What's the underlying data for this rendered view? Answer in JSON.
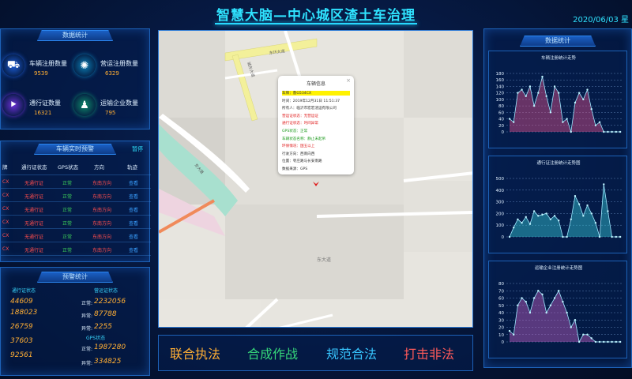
{
  "header": {
    "title": "智慧大脑—中心城区渣土车治理",
    "date": "2020/06/03 星"
  },
  "stats": {
    "title": "数据统计",
    "items": [
      {
        "label": "车辆注册数量",
        "value": "9539",
        "color": "#1d5dd8",
        "icon": "truck-icon",
        "glyph": "⛟"
      },
      {
        "label": "营运注册数量",
        "value": "6329",
        "color": "#0b7fb5",
        "icon": "network-icon",
        "glyph": "✺"
      },
      {
        "label": "通行证数量",
        "value": "16321",
        "color": "#6b2fd6",
        "icon": "pass-icon",
        "glyph": "⯈"
      },
      {
        "label": "运输企业数量",
        "value": "795",
        "color": "#0e8a6a",
        "icon": "enterprise-icon",
        "glyph": "♟"
      }
    ]
  },
  "warnings": {
    "title": "车辆实时预警",
    "pause": "暂停",
    "columns": [
      "牌",
      "通行证状态",
      "GPS状态",
      "方向",
      "轨迹"
    ],
    "rows": [
      {
        "plate": "CX",
        "pass": "无通行证",
        "gps": "正常",
        "dir": "东南方向",
        "track": "查看"
      },
      {
        "plate": "CX",
        "pass": "无通行证",
        "gps": "正常",
        "dir": "东南方向",
        "track": "查看"
      },
      {
        "plate": "CX",
        "pass": "无通行证",
        "gps": "正常",
        "dir": "东南方向",
        "track": "查看"
      },
      {
        "plate": "CX",
        "pass": "无通行证",
        "gps": "正常",
        "dir": "东南方向",
        "track": "查看"
      },
      {
        "plate": "CX",
        "pass": "无通行证",
        "gps": "正常",
        "dir": "东南方向",
        "track": "查看"
      },
      {
        "plate": "CX",
        "pass": "无通行证",
        "gps": "正常",
        "dir": "东南方向",
        "track": "查看"
      }
    ]
  },
  "alarm": {
    "title": "预警统计",
    "pass_title": "通行证状态",
    "op_title": "营运证状态",
    "gps_title": "GPS状态",
    "left": [
      {
        "label": "",
        "value": "44609"
      },
      {
        "label": "",
        "value": "188023"
      },
      {
        "label": "",
        "value": "26759"
      },
      {
        "label": "",
        "value": "37603"
      },
      {
        "label": "",
        "value": "92561"
      }
    ],
    "right": [
      {
        "label": "正常:",
        "value": "2232056"
      },
      {
        "label": "异常:",
        "value": "87788"
      },
      {
        "label": "异常:",
        "value": "2255"
      },
      {
        "label": "正常:",
        "value": "1987280"
      },
      {
        "label": "异常:",
        "value": "334825"
      }
    ]
  },
  "map": {
    "road1": "城东大道",
    "road2": "东环大道",
    "road3": "东大道",
    "road4": "东大道"
  },
  "popup": {
    "title": "车辆信息",
    "rows": [
      {
        "text": "车牌：鲁G534CX",
        "color": "#333",
        "highlight": true
      },
      {
        "text": "时间：2019年12月31日 11:51:37",
        "color": "#333"
      },
      {
        "text": "所有人：临沂市宏宏渣运有限公司",
        "color": "#333"
      },
      {
        "text": "营运证状态：无营运证",
        "color": "#e02020"
      },
      {
        "text": "通行证状态：时间异常",
        "color": "#e02020"
      },
      {
        "text": "GPS状态：正常",
        "color": "#1a9a1a"
      },
      {
        "text": "车辆状态名称：静止未起吊",
        "color": "#1a9a1a"
      },
      {
        "text": "环保情况：国五以上",
        "color": "#e02020"
      },
      {
        "text": "行驶方向：西南向西",
        "color": "#333"
      },
      {
        "text": "位置：枣庄路与长安南路",
        "color": "#333"
      },
      {
        "text": "数据来源：GPS",
        "color": "#333"
      }
    ]
  },
  "actions": [
    {
      "label": "联合执法",
      "color": "#ffae34"
    },
    {
      "label": "合成作战",
      "color": "#35d67a"
    },
    {
      "label": "规范合法",
      "color": "#38c6ff"
    },
    {
      "label": "打击非法",
      "color": "#ff5a5a"
    }
  ],
  "right_panel": {
    "title": "数据统计"
  },
  "chart_data": [
    {
      "type": "area",
      "title": "车辆注册统计走势",
      "ylim": [
        0,
        180
      ],
      "yticks": [
        0,
        20,
        40,
        60,
        80,
        100,
        120,
        140,
        160,
        180
      ],
      "color": "#e0508a",
      "values": [
        40,
        30,
        120,
        130,
        110,
        140,
        80,
        120,
        170,
        110,
        60,
        140,
        120,
        30,
        40,
        0,
        90,
        120,
        100,
        130,
        70,
        20,
        30,
        0,
        0,
        0,
        0,
        0
      ]
    },
    {
      "type": "area",
      "title": "通行证注册统计走势图",
      "ylim": [
        0,
        500
      ],
      "yticks": [
        0,
        100,
        200,
        300,
        400,
        500
      ],
      "color": "#36c9d6",
      "values": [
        0,
        80,
        150,
        120,
        170,
        110,
        220,
        180,
        190,
        200,
        150,
        180,
        140,
        0,
        0,
        150,
        350,
        280,
        180,
        270,
        200,
        120,
        0,
        450,
        220,
        0,
        0,
        0
      ]
    },
    {
      "type": "area",
      "title": "运输企业注册统计走势图",
      "ylim": [
        0,
        80
      ],
      "yticks": [
        0,
        10,
        20,
        30,
        40,
        50,
        60,
        70,
        80
      ],
      "color": "#c060c0",
      "values": [
        15,
        10,
        50,
        60,
        55,
        40,
        60,
        70,
        65,
        40,
        50,
        60,
        70,
        55,
        40,
        20,
        30,
        0,
        10,
        10,
        5,
        0,
        0,
        0,
        0,
        0,
        0,
        0
      ]
    }
  ]
}
